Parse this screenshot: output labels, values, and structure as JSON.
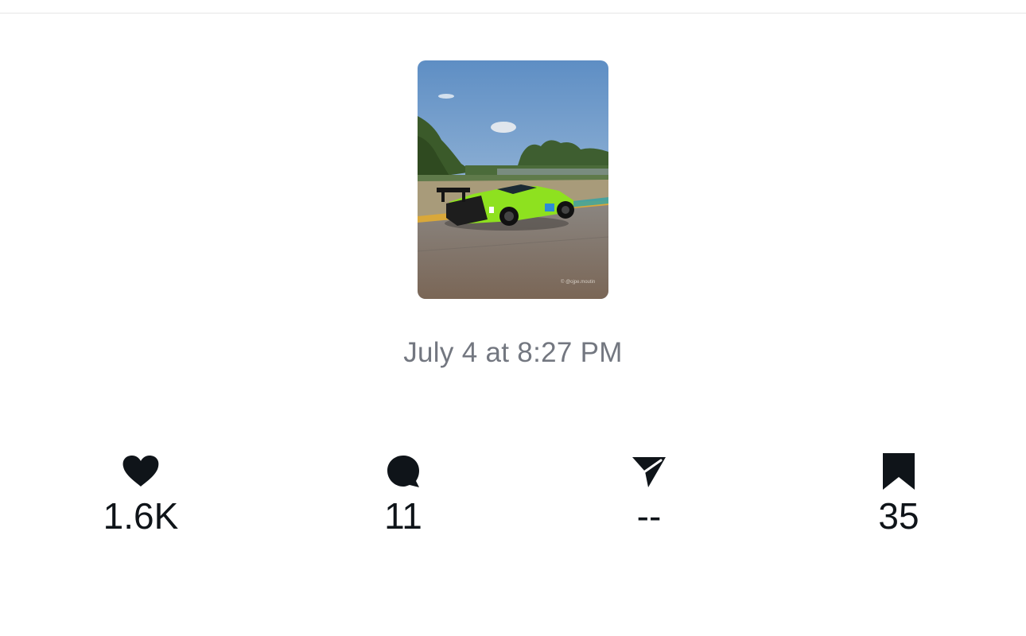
{
  "post": {
    "timestamp": "July 4 at 8:27 PM",
    "image_watermark": "© @ojpe.moutin"
  },
  "stats": {
    "likes": {
      "icon": "heart-icon",
      "count": "1.6K"
    },
    "replies": {
      "icon": "comment-bubble-icon",
      "count": "11"
    },
    "shares": {
      "icon": "send-icon",
      "count": "--"
    },
    "bookmarks": {
      "icon": "bookmark-icon",
      "count": "35"
    }
  },
  "colors": {
    "text_primary": "#0f1419",
    "text_secondary": "#737780",
    "car_livery": "#8ee11f",
    "divider": "#e6e6e6"
  }
}
